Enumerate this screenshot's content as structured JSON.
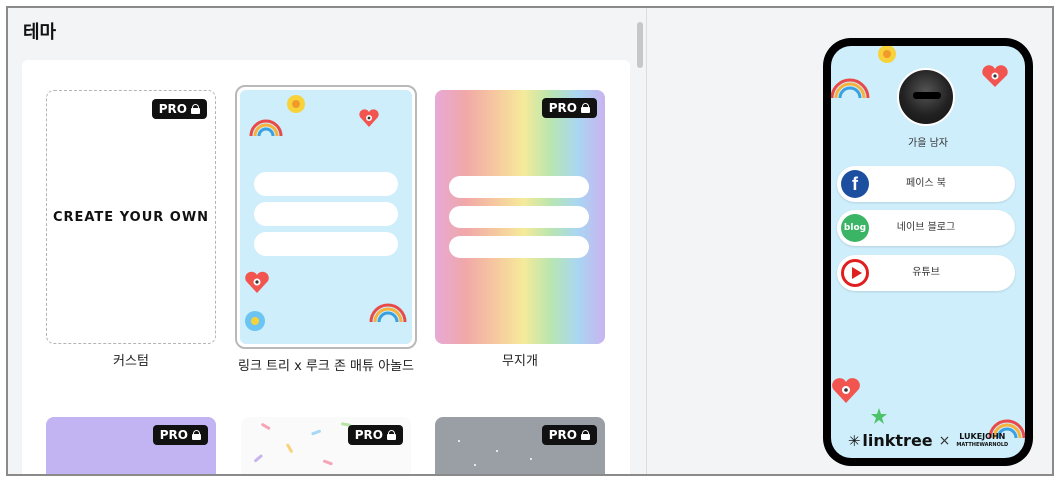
{
  "theme_panel": {
    "title": "테마",
    "pro_label": "PRO",
    "themes": [
      {
        "name": "custom",
        "caption": "커스텀",
        "thumb_text": "CREATE YOUR OWN",
        "pro": true
      },
      {
        "name": "linktree-luke",
        "caption": "링크 트리 x 루크 존 매튜 아놀드",
        "pro": false,
        "selected": true
      },
      {
        "name": "rainbow",
        "caption": "무지개",
        "pro": true
      },
      {
        "name": "purple",
        "caption": "",
        "pro": true
      },
      {
        "name": "confetti",
        "caption": "",
        "pro": true
      },
      {
        "name": "grey",
        "caption": "",
        "pro": true
      }
    ]
  },
  "preview": {
    "profile_name": "가을 남자",
    "links": [
      {
        "label": "페이스 북",
        "icon": "facebook-icon",
        "icon_text": "f"
      },
      {
        "label": "네이브 블로그",
        "icon": "blog-icon",
        "icon_text": "blog"
      },
      {
        "label": "유튜브",
        "icon": "youtube-icon",
        "icon_text": ""
      }
    ],
    "footer": {
      "brand": "linktree",
      "separator": "×",
      "partner_line1": "LUKEJOHN",
      "partner_line2": "MATTHEWARNOLD"
    }
  },
  "colors": {
    "preview_background": "#cdeefa",
    "pro_badge": "#111111",
    "facebook": "#1d4fa0",
    "blog": "#3bb565",
    "youtube": "#e02020"
  }
}
